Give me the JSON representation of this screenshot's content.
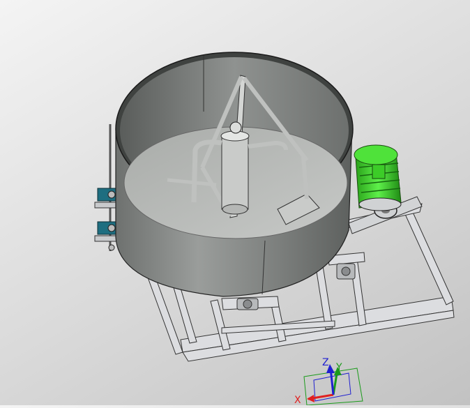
{
  "viewport": {
    "background_top": "#f4f4f4",
    "background_bottom": "#c2c2c2",
    "model": {
      "body_color": "#8c8f8c",
      "frame_color": "#dcdde0",
      "motor_color": "#3fdc2a",
      "base_color": "#1e6e80"
    },
    "triad": {
      "x_label": "X",
      "y_label": "Y",
      "z_label": "Z",
      "x_color": "#e02020",
      "y_color": "#1a9a1a",
      "z_color": "#2020d0"
    }
  }
}
